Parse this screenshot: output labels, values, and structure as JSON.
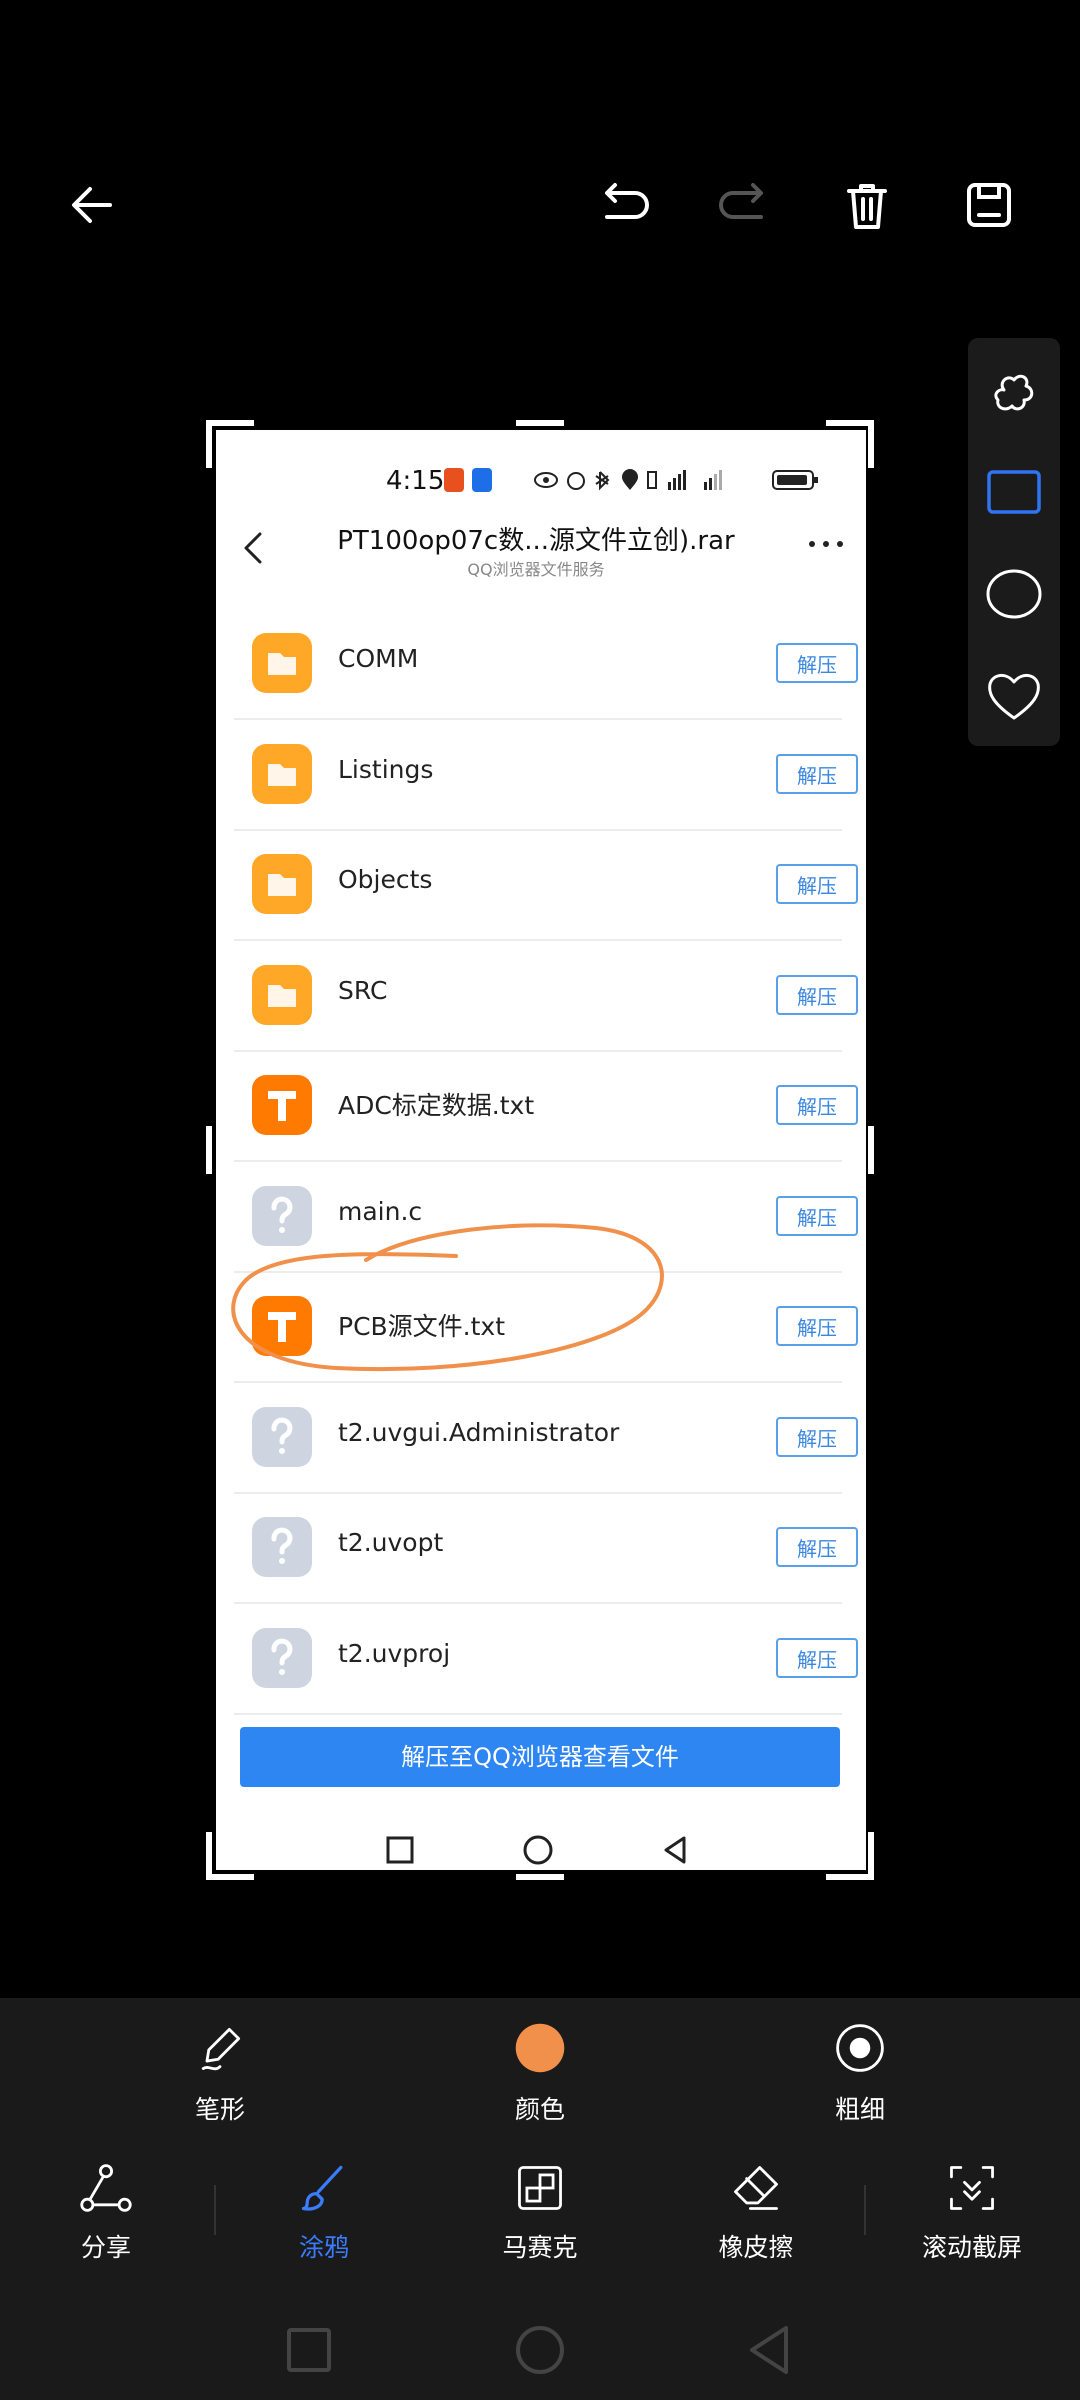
{
  "editor": {
    "options": [
      {
        "name": "pen-style",
        "label": "笔形"
      },
      {
        "name": "color",
        "label": "颜色"
      },
      {
        "name": "thickness",
        "label": "粗细"
      }
    ],
    "tools": [
      {
        "name": "share",
        "label": "分享"
      },
      {
        "name": "doodle",
        "label": "涂鸦"
      },
      {
        "name": "mosaic",
        "label": "马赛克"
      },
      {
        "name": "eraser",
        "label": "橡皮擦"
      },
      {
        "name": "scroll-screenshot",
        "label": "滚动截屏"
      }
    ],
    "active_tool": "涂鸦",
    "colors": {
      "accent": "#3a7cff",
      "selected_color": "#f0904a"
    }
  },
  "screenshot": {
    "status_time": "4:15",
    "header": {
      "title": "PT100op07c数...源文件立创).rar",
      "subtitle": "QQ浏览器文件服务"
    },
    "files": [
      {
        "name": "COMM",
        "type": "folder",
        "action": "解压"
      },
      {
        "name": "Listings",
        "type": "folder",
        "action": "解压"
      },
      {
        "name": "Objects",
        "type": "folder",
        "action": "解压"
      },
      {
        "name": "SRC",
        "type": "folder",
        "action": "解压"
      },
      {
        "name": "ADC标定数据.txt",
        "type": "txt",
        "action": "解压"
      },
      {
        "name": "main.c",
        "type": "unknown",
        "action": "解压"
      },
      {
        "name": "PCB源文件.txt",
        "type": "txt",
        "action": "解压"
      },
      {
        "name": "t2.uvgui.Administrator",
        "type": "unknown",
        "action": "解压"
      },
      {
        "name": "t2.uvopt",
        "type": "unknown",
        "action": "解压"
      },
      {
        "name": "t2.uvproj",
        "type": "unknown",
        "action": "解压"
      }
    ],
    "extract_button": "解压至QQ浏览器查看文件"
  }
}
